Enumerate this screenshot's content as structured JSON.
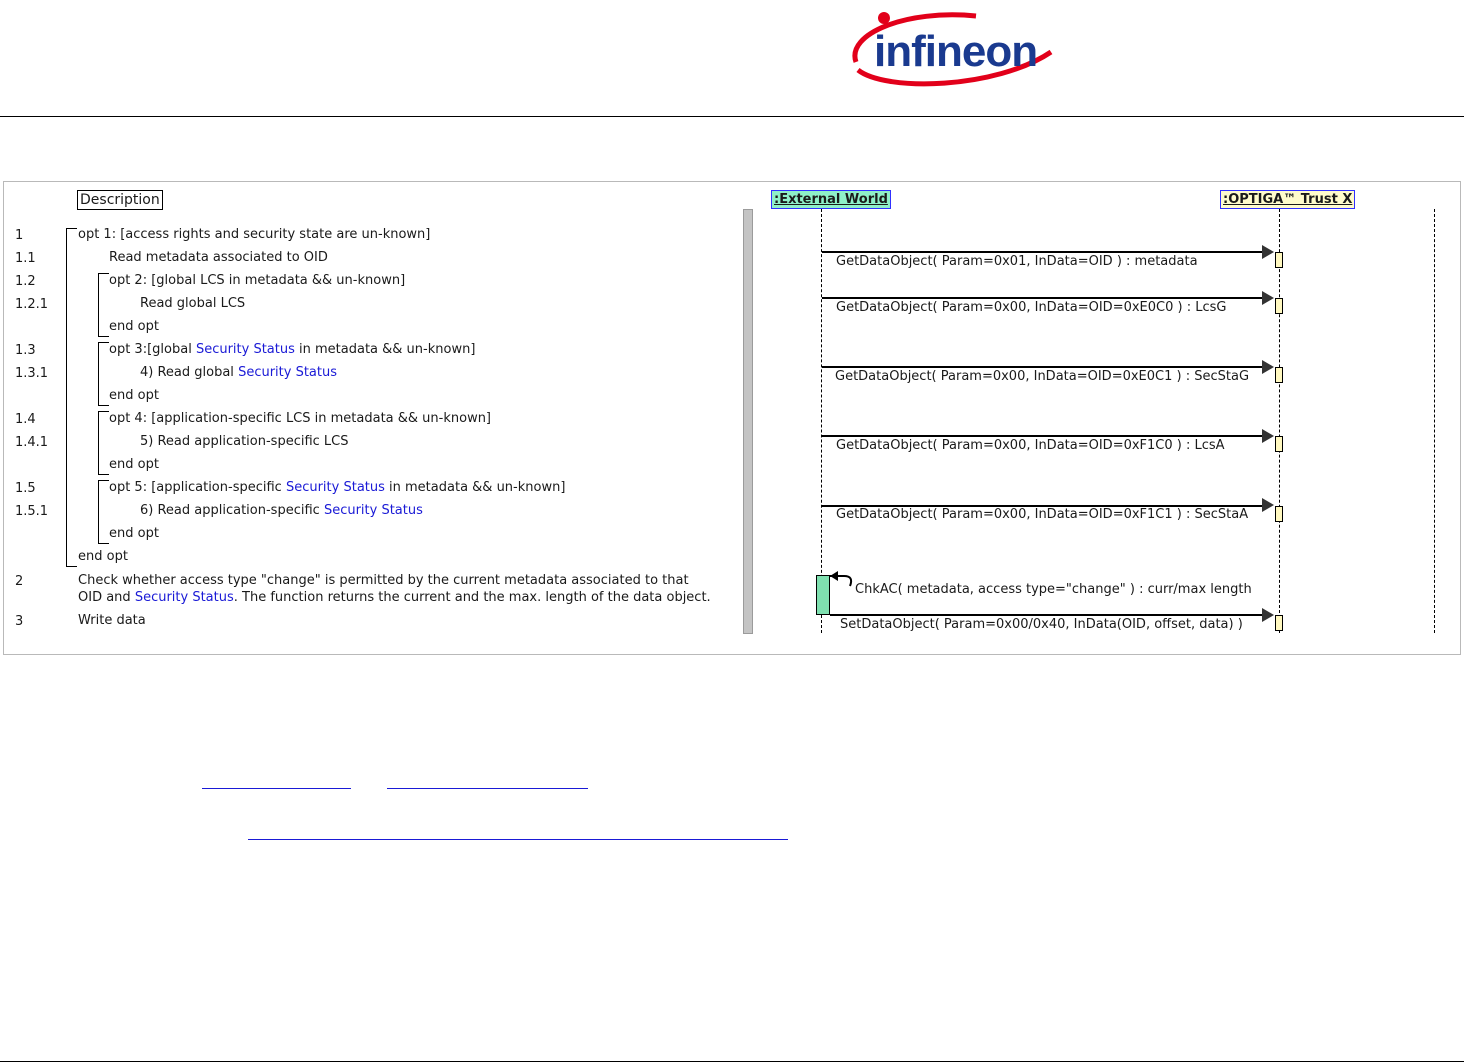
{
  "header": {
    "logo_text": "infineon"
  },
  "description": {
    "heading": "Description",
    "rows": [
      {
        "num": "1",
        "text": "opt 1: [access rights and security state are un-known]"
      },
      {
        "num": "1.1",
        "text": "Read metadata associated to OID"
      },
      {
        "num": "1.2",
        "text": "opt 2: [global LCS in metadata && un-known]"
      },
      {
        "num": "1.2.1",
        "text": "Read global LCS"
      },
      {
        "end_opt_2": "end opt"
      },
      {
        "num": "1.3",
        "pre": "opt 3:[global ",
        "blue": "Security Status",
        "post": " in metadata && un-known]"
      },
      {
        "num": "1.3.1",
        "pre": "4) Read global ",
        "blue": "Security Status",
        "post": ""
      },
      {
        "end_opt_3": "end opt"
      },
      {
        "num": "1.4",
        "text": "opt 4: [application-specific LCS in metadata && un-known]"
      },
      {
        "num": "1.4.1",
        "text": "5) Read application-specific LCS"
      },
      {
        "end_opt_4": "end opt"
      },
      {
        "num": "1.5",
        "pre": "opt 5: [application-specific ",
        "blue": "Security Status",
        "post": " in metadata && un-known]"
      },
      {
        "num": "1.5.1",
        "pre": "6) Read application-specific ",
        "blue": "Security Status",
        "post": ""
      },
      {
        "end_opt_5": "end opt"
      },
      {
        "end_opt_1": "end opt"
      },
      {
        "num": "2",
        "line1": "Check whether access type \"change\" is permitted by the current metadata associated to that",
        "line2_pre": "OID and ",
        "line2_blue": "Security Status",
        "line2_post": ". The function returns the current and the max. length of the data object."
      },
      {
        "num": "3",
        "text": "Write data"
      }
    ]
  },
  "lifelines": {
    "external": ":External World",
    "optiga": ":OPTIGA™ Trust X"
  },
  "messages": [
    "GetDataObject( Param=0x01, InData=OID ) : metadata",
    "GetDataObject( Param=0x00, InData=OID=0xE0C0 ) : LcsG",
    "GetDataObject( Param=0x00, InData=OID=0xE0C1 ) : SecStaG",
    "GetDataObject( Param=0x00, InData=OID=0xF1C0 ) : LcsA",
    "GetDataObject( Param=0x00, InData=OID=0xF1C1 ) : SecStaA",
    "ChkAC( metadata, access type=\"change\" ) : curr/max length",
    "SetDataObject( Param=0x00/0x40, InData(OID, offset, data) )"
  ],
  "colors": {
    "brand_red": "#e2001a",
    "brand_blue": "#1a3a8f",
    "link_blue": "#1a1ad6",
    "ext_fill": "#8ff0c8",
    "optiga_fill": "#fffccc",
    "activation_fill": "#fff8c0",
    "self_act_fill": "#7fe0b0"
  }
}
